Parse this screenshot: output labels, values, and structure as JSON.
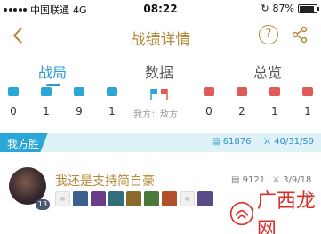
{
  "status_bar": {
    "carrier": "中国联通",
    "network": "4G",
    "time": "08:22",
    "battery": "87%",
    "battery_level": 0.87
  },
  "header": {
    "title": "战绩详情",
    "help_label": "?"
  },
  "tabs": [
    {
      "label": "战局",
      "active": true
    },
    {
      "label": "数据",
      "active": false
    },
    {
      "label": "总览",
      "active": false
    }
  ],
  "stats": {
    "ally_counts": [
      "0",
      "1",
      "9",
      "1"
    ],
    "enemy_counts": [
      "0",
      "2",
      "1",
      "1"
    ],
    "vs_label": "我方：敌方",
    "ally_color": "#2aa7d6",
    "enemy_color": "#e15a5a"
  },
  "team": {
    "result_label": "我方胜",
    "gold": "61876",
    "kda": "40/31/59"
  },
  "player": {
    "name": "我还是支持简自豪",
    "level": "13",
    "gold": "9121",
    "kda": "3/9/18",
    "items": [
      "empty",
      "item",
      "item",
      "item",
      "item",
      "item",
      "item",
      "empty",
      "item"
    ]
  },
  "watermark": {
    "text": "广西龙网"
  }
}
